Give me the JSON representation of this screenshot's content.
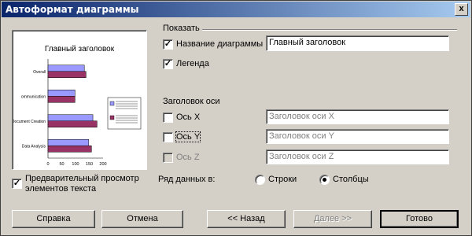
{
  "window": {
    "title": "Автоформат диаграммы",
    "close_glyph": "x"
  },
  "show_group": {
    "label": "Показать",
    "chart_title": {
      "label": "Название диаграммы",
      "checked": true,
      "value": "Главный заголовок"
    },
    "legend": {
      "label": "Легенда",
      "checked": true
    }
  },
  "axis_title_group": {
    "label": "Заголовок оси",
    "axes": [
      {
        "label": "Ось X",
        "accesskey": "X",
        "checked": false,
        "enabled": true,
        "placeholder": "Заголовок оси X"
      },
      {
        "label": "Ось Y",
        "accesskey": "Y",
        "checked": false,
        "enabled": true,
        "placeholder": "Заголовок оси Y"
      },
      {
        "label": "Ось Z",
        "accesskey": "Z",
        "checked": false,
        "enabled": false,
        "placeholder": "Заголовок оси Z"
      }
    ]
  },
  "series_in": {
    "label": "Ряд данных в:",
    "options": [
      {
        "label": "Строки",
        "selected": false
      },
      {
        "label": "Столбцы",
        "selected": true
      }
    ]
  },
  "preview_text": {
    "label": "Предварительный просмотр элементов текста",
    "checked": true
  },
  "buttons": {
    "help": "Справка",
    "cancel": "Отмена",
    "back": "<< Назад",
    "next": "Далее >>",
    "done": "Готово"
  },
  "chart_data": {
    "type": "bar",
    "title": "Главный заголовок",
    "categories": [
      "Data Analysis",
      "Document Creation",
      "Communication",
      "Overall"
    ],
    "category_labels_shown": [
      "Data Analysis",
      "Document Creation",
      "ommunication",
      "Overall"
    ],
    "series": [
      {
        "values": [
          148,
          163,
          98,
          132
        ],
        "color": "#9999ff"
      },
      {
        "values": [
          158,
          178,
          98,
          138
        ],
        "color": "#993366"
      }
    ],
    "legend_placement": "right",
    "xticks": [
      0,
      50,
      100,
      150,
      200
    ],
    "xlim": [
      0,
      200
    ]
  }
}
